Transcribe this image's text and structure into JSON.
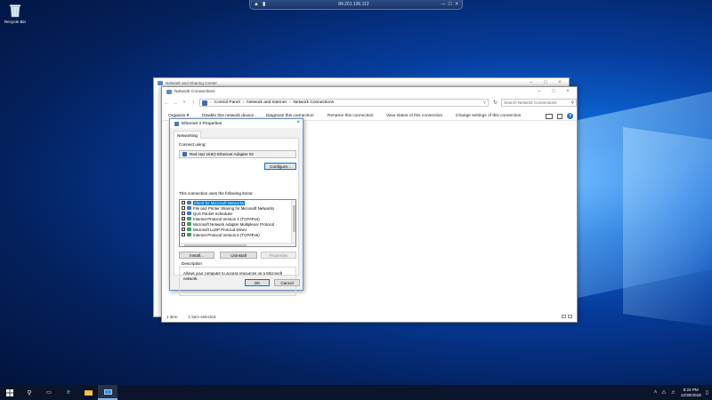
{
  "remote_bar": {
    "address": "84.201.136.112"
  },
  "desktop": {
    "recycle_bin_label": "Recycle Bin"
  },
  "back_window": {
    "title": "Network and Sharing Center"
  },
  "main_window": {
    "title": "Network Connections",
    "address_path": [
      "Control Panel",
      "Network and Internet",
      "Network Connections"
    ],
    "search_placeholder": "Search Network Connections",
    "commands": {
      "organize": "Organize",
      "disable": "Disable this network device",
      "diagnose": "Diagnose this connection",
      "rename": "Rename this connection",
      "view_status": "View status of this connection",
      "change_settings": "Change settings of this connection"
    },
    "status": {
      "count": "1 item",
      "selected": "1 item selected"
    }
  },
  "dialog": {
    "title": "Ethernet 2 Properties",
    "tab": "Networking",
    "connect_using_label": "Connect using:",
    "adapter": "Red Hat VirtIO Ethernet Adapter #2",
    "configure_btn": "Configure...",
    "items_label": "This connection uses the following items:",
    "items": [
      {
        "label": "Client for Microsoft Networks",
        "checked": false,
        "selected": true
      },
      {
        "label": "File and Printer Sharing for Microsoft Networks",
        "checked": false,
        "selected": false
      },
      {
        "label": "QoS Packet Scheduler",
        "checked": false,
        "selected": false
      },
      {
        "label": "Internet Protocol Version 4 (TCP/IPv4)",
        "checked": true,
        "selected": false
      },
      {
        "label": "Microsoft Network Adapter Multiplexor Protocol",
        "checked": false,
        "selected": false
      },
      {
        "label": "Microsoft LLDP Protocol Driver",
        "checked": false,
        "selected": false
      },
      {
        "label": "Internet Protocol Version 6 (TCP/IPv6)",
        "checked": false,
        "selected": false
      }
    ],
    "install_btn": "Install...",
    "uninstall_btn": "Uninstall",
    "properties_btn": "Properties",
    "description_label": "Description",
    "description_text": "Allows your computer to access resources on a Microsoft network.",
    "ok_btn": "OK",
    "cancel_btn": "Cancel"
  },
  "taskbar": {
    "time": "8:24 PM",
    "date": "12/30/2018"
  }
}
